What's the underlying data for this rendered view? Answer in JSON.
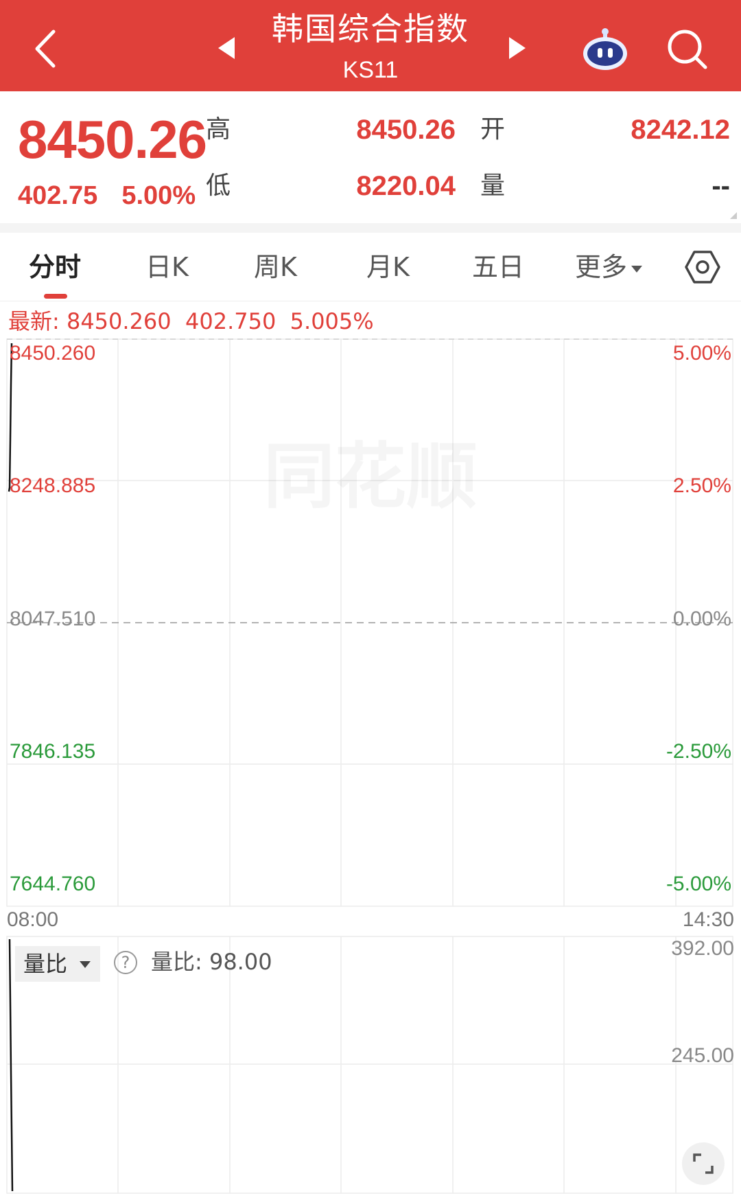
{
  "header": {
    "title": "韩国综合指数",
    "subtitle": "KS11",
    "icons": [
      "back-icon",
      "prev-arrow-icon",
      "next-arrow-icon",
      "robot-assistant-icon",
      "search-icon"
    ],
    "bg_color": "#e0403a"
  },
  "quote": {
    "price": "8450.26",
    "change": "402.75",
    "change_pct": "5.00%",
    "high_label": "高",
    "high_value": "8450.26",
    "open_label": "开",
    "open_value": "8242.12",
    "low_label": "低",
    "low_value": "8220.04",
    "volume_label": "量",
    "volume_value": "--"
  },
  "tabs": {
    "items": [
      "分时",
      "日K",
      "周K",
      "月K",
      "五日",
      "更多"
    ],
    "active_index": 0
  },
  "latest": {
    "text": "最新: 8450.260  402.750  5.005%"
  },
  "chart": {
    "left_axis": [
      "8450.260",
      "8248.885",
      "8047.510",
      "7846.135",
      "7644.760"
    ],
    "right_axis": [
      "5.00%",
      "2.50%",
      "0.00%",
      "-2.50%",
      "-5.00%"
    ],
    "time_start": "08:00",
    "time_end": "14:30",
    "watermark": "同花顺"
  },
  "volume": {
    "selector_label": "量比",
    "ratio_text": "量比: 98.00",
    "axis_top": "392.00",
    "axis_mid": "245.00"
  },
  "colors": {
    "up": "#e0403a",
    "down": "#2a9a3a"
  }
}
